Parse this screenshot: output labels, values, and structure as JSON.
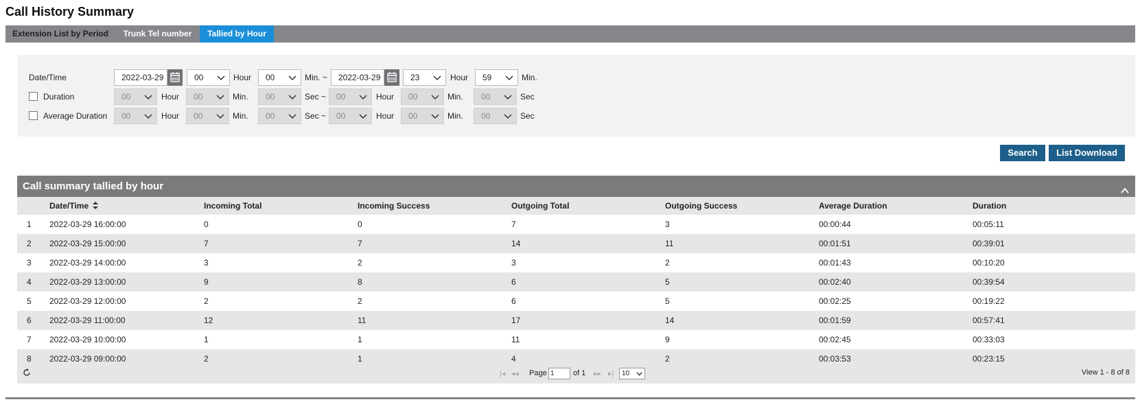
{
  "page": {
    "title": "Call History Summary"
  },
  "tabs": [
    {
      "label": "Extension List by Period"
    },
    {
      "label": "Trunk Tel number"
    },
    {
      "label": "Tallied by Hour"
    }
  ],
  "filters": {
    "datetime_label": "Date/Time",
    "duration_label": "Duration",
    "avg_duration_label": "Average Duration",
    "start_date": "2022-03-29",
    "end_date": "2022-03-29",
    "start_hour": "00",
    "start_min": "00",
    "end_hour": "23",
    "end_min": "59",
    "disabled_value": "00",
    "unit_hour": "Hour",
    "unit_min": "Min.",
    "unit_sec": "Sec",
    "unit_min_tilde": "Min. ~",
    "unit_sec_tilde": "Sec ~"
  },
  "actions": {
    "search": "Search",
    "download": "List Download"
  },
  "grid": {
    "title": "Call summary tallied by hour",
    "columns": [
      "Date/Time",
      "Incoming Total",
      "Incoming Success",
      "Outgoing Total",
      "Outgoing Success",
      "Average Duration",
      "Duration"
    ],
    "rows": [
      [
        "1",
        "2022-03-29 16:00:00",
        "0",
        "0",
        "7",
        "3",
        "00:00:44",
        "00:05:11"
      ],
      [
        "2",
        "2022-03-29 15:00:00",
        "7",
        "7",
        "14",
        "11",
        "00:01:51",
        "00:39:01"
      ],
      [
        "3",
        "2022-03-29 14:00:00",
        "3",
        "2",
        "3",
        "2",
        "00:01:43",
        "00:10:20"
      ],
      [
        "4",
        "2022-03-29 13:00:00",
        "9",
        "8",
        "6",
        "5",
        "00:02:40",
        "00:39:54"
      ],
      [
        "5",
        "2022-03-29 12:00:00",
        "2",
        "2",
        "6",
        "5",
        "00:02:25",
        "00:19:22"
      ],
      [
        "6",
        "2022-03-29 11:00:00",
        "12",
        "11",
        "17",
        "14",
        "00:01:59",
        "00:57:41"
      ],
      [
        "7",
        "2022-03-29 10:00:00",
        "1",
        "1",
        "11",
        "9",
        "00:02:45",
        "00:33:03"
      ],
      [
        "8",
        "2022-03-29 09:00:00",
        "2",
        "1",
        "4",
        "2",
        "00:03:53",
        "00:23:15"
      ]
    ]
  },
  "pager": {
    "page_label": "Page",
    "page_value": "1",
    "of_label": "of 1",
    "page_size": "10",
    "view_text": "View 1 - 8 of 8"
  },
  "colors": {
    "accent": "#1a8fd8",
    "button": "#1d5f8a",
    "header_bar": "#7b7b7e"
  }
}
